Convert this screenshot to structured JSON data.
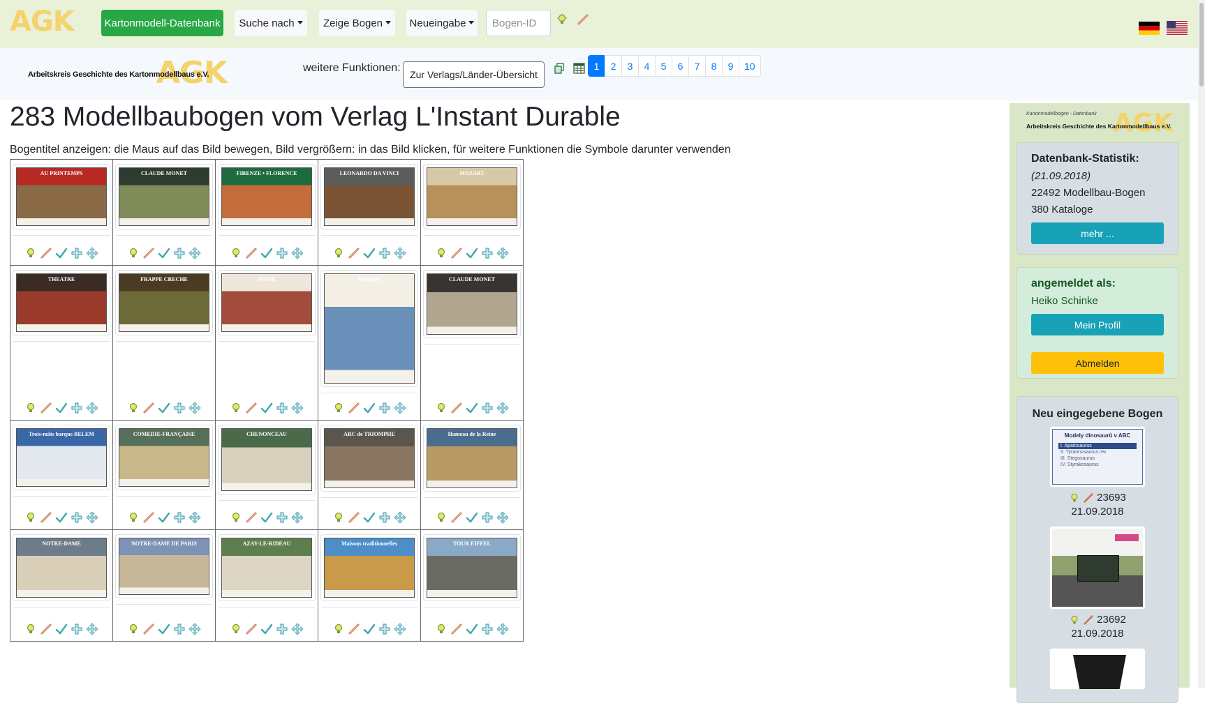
{
  "navbar": {
    "logo": "AGK",
    "db_button": "Kartonmodell-Datenbank",
    "search_menu": "Suche nach",
    "show_menu": "Zeige Bogen",
    "new_menu": "Neueingabe",
    "bogen_id_placeholder": "Bogen-ID",
    "flags": [
      "flag-germany-icon",
      "flag-usa-icon"
    ]
  },
  "subbar": {
    "logo_big": "AGK",
    "logo_text": "Arbeitskreis Geschichte des Kartonmodellbaus e.V.",
    "functions_label": "weitere Funktionen:",
    "functions_button": "Zur Verlags/Länder-Übersicht",
    "pages": [
      "1",
      "2",
      "3",
      "4",
      "5",
      "6",
      "7",
      "8",
      "9",
      "10"
    ],
    "active_page": "1"
  },
  "main": {
    "title": "283 Modellbaubogen vom Verlag L'Instant Durable",
    "hint": "Bogentitel anzeigen: die Maus auf das Bild bewegen, Bild vergrößern: in das Bild klicken, für weitere Funktionen die Symbole darunter verwenden",
    "grid": [
      [
        {
          "caption": "AU PRINTEMPS",
          "bg": "#b72a24",
          "scene": "#8b6a48"
        },
        {
          "caption": "CLAUDE MONET",
          "bg": "#2d3b30",
          "scene": "#7f8b59"
        },
        {
          "caption": "FIRENZE • FLORENCE",
          "bg": "#1e6b3f",
          "scene": "#c26d3a"
        },
        {
          "caption": "LEONARDO DA VINCI",
          "bg": "#5a5d5a",
          "scene": "#7a5234"
        },
        {
          "caption": "MOZART",
          "bg": "#d8c9a6",
          "scene": "#b8905b"
        }
      ],
      [
        {
          "caption": "THEATRE",
          "bg": "#3b2b25",
          "scene": "#9a3a2a"
        },
        {
          "caption": "FRAPPE CRECHE",
          "bg": "#4a3b22",
          "scene": "#6d6a3a"
        },
        {
          "caption": "MODE",
          "bg": "#efe7dc",
          "scene": "#a34b3c"
        },
        {
          "caption": "Mésanges",
          "bg": "#f3efe5",
          "scene": "#6a8fb8"
        },
        {
          "caption": "CLAUDE MONET",
          "bg": "#3a3430",
          "scene": "#b0a58e"
        }
      ],
      [
        {
          "caption": "Trois-mâts barque BELEM",
          "bg": "#3a67a8",
          "scene": "#e2e8ee"
        },
        {
          "caption": "COMEDIE-FRANÇAISE",
          "bg": "#566f58",
          "scene": "#c9b98a"
        },
        {
          "caption": "CHENONCEAU",
          "bg": "#4b6a4a",
          "scene": "#d6d0bc"
        },
        {
          "caption": "ARC de TRIOMPHE",
          "bg": "#5a564e",
          "scene": "#8a7660"
        },
        {
          "caption": "Hameau de la Reine",
          "bg": "#4a6d8e",
          "scene": "#b89a64"
        }
      ],
      [
        {
          "caption": "NOTRE-DAME",
          "bg": "#6d7c89",
          "scene": "#d9cfb9"
        },
        {
          "caption": "NOTRE-DAME DE PARIS",
          "bg": "#7d93b5",
          "scene": "#c6b79a"
        },
        {
          "caption": "AZAY-LE-RIDEAU",
          "bg": "#5f7e4e",
          "scene": "#ddd6c4"
        },
        {
          "caption": "Maisons traditionnelles",
          "bg": "#4d8ec9",
          "scene": "#c89a4a"
        },
        {
          "caption": "TOUR EIFFEL",
          "bg": "#8aa9c7",
          "scene": "#6b6b66"
        }
      ]
    ]
  },
  "sidebar": {
    "logo_big": "AGK",
    "logo_tiny": "Kartonmodellbogen - Datenbank",
    "logo_text": "Arbeitskreis Geschichte des Kartonmodellbaus e.V.",
    "stats": {
      "title": "Datenbank-Statistik:",
      "date": "(21.09.2018)",
      "sheets": "22492 Modellbau-Bogen",
      "catalogs": "380 Kataloge",
      "more": "mehr ..."
    },
    "login": {
      "title": "angemeldet als:",
      "user": "Heiko Schinke",
      "profile": "Mein Profil",
      "logout": "Abmelden"
    },
    "new_entries": {
      "title": "Neu eingegebene Bogen",
      "items": [
        {
          "id": "23693",
          "date": "21.09.2018",
          "thumb_title": "Modely dinosaurů v ABC",
          "list": [
            "I.   Apatosaurus",
            "II.  Tyrannosaurus rex",
            "III. Stegosaurus",
            "IV.  Styrakosaurus"
          ]
        },
        {
          "id": "23692",
          "date": "21.09.2018",
          "thumb_title": ""
        }
      ]
    }
  }
}
